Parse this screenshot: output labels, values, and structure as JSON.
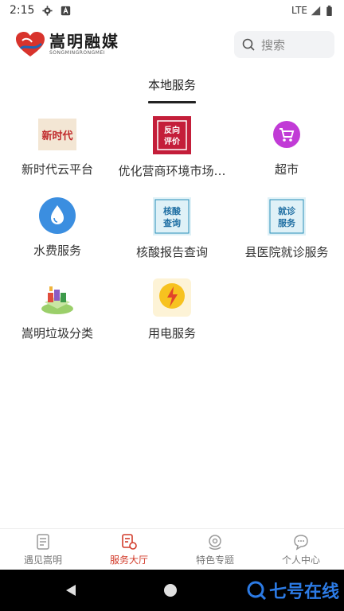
{
  "status_bar": {
    "time": "2:15",
    "network": "LTE"
  },
  "header": {
    "logo_cn": "嵩明融媒",
    "logo_en": "SONGMINGRONGMEI",
    "search_placeholder": "搜索"
  },
  "section": {
    "title": "本地服务"
  },
  "services": [
    {
      "label": "新时代云平台",
      "icon": "xinshidai-icon"
    },
    {
      "label": "优化营商环境市场…",
      "icon": "fanxiang-pingjia-icon"
    },
    {
      "label": "超市",
      "icon": "shopping-cart-icon"
    },
    {
      "label": "水费服务",
      "icon": "water-drop-icon"
    },
    {
      "label": "核酸报告查询",
      "icon": "nucleic-acid-icon"
    },
    {
      "label": "县医院就诊服务",
      "icon": "hospital-visit-icon"
    },
    {
      "label": "嵩明垃圾分类",
      "icon": "garbage-sorting-icon"
    },
    {
      "label": "用电服务",
      "icon": "lightning-bulb-icon"
    }
  ],
  "icon_text": {
    "xinshidai": "新时代",
    "fanxiang": "反向",
    "pingjia": "评价",
    "hesuan": "核酸",
    "chaxun": "查询",
    "jiuzhen": "就诊",
    "fuwu": "服务"
  },
  "tabbar": {
    "tabs": [
      {
        "label": "遇见嵩明"
      },
      {
        "label": "服务大厅"
      },
      {
        "label": "特色专题"
      },
      {
        "label": "个人中心"
      }
    ],
    "active_color": "#d23b2a"
  },
  "watermark": {
    "text": "七号在线"
  }
}
